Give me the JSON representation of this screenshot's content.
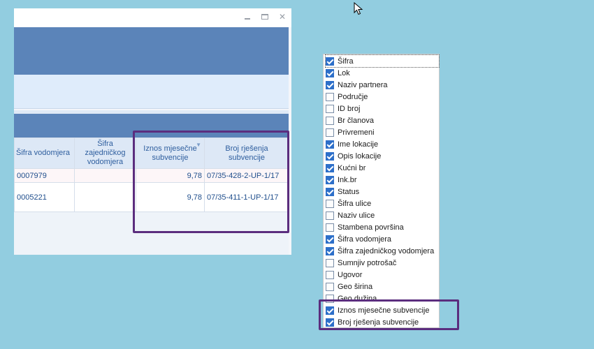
{
  "window": {
    "controls": {
      "minimize": "",
      "maximize": "",
      "close": "✕"
    }
  },
  "grid": {
    "columns": [
      {
        "label": "Šifra vodomjera"
      },
      {
        "label": "Šifra zajedničkog vodomjera"
      },
      {
        "label": "Iznos mjesečne subvencije",
        "filter_icon": "▼"
      },
      {
        "label": "Broj rješenja subvencije"
      }
    ],
    "rows": [
      [
        "0007979",
        "",
        "9,78",
        "07/35-428-2-UP-1/17"
      ],
      [
        "0005221",
        "",
        "9,78",
        "07/35-411-1-UP-1/17"
      ]
    ]
  },
  "column_chooser": {
    "items": [
      {
        "label": "Šifra",
        "checked": true
      },
      {
        "label": "Lok",
        "checked": true
      },
      {
        "label": "Naziv partnera",
        "checked": true
      },
      {
        "label": "Područje",
        "checked": false
      },
      {
        "label": "ID broj",
        "checked": false
      },
      {
        "label": "Br članova",
        "checked": false
      },
      {
        "label": "Privremeni",
        "checked": false
      },
      {
        "label": "Ime lokacije",
        "checked": true
      },
      {
        "label": "Opis lokacije",
        "checked": true
      },
      {
        "label": "Kućni br",
        "checked": true
      },
      {
        "label": "Ink.br",
        "checked": true
      },
      {
        "label": "Status",
        "checked": true
      },
      {
        "label": "Šifra ulice",
        "checked": false
      },
      {
        "label": "Naziv ulice",
        "checked": false
      },
      {
        "label": "Stambena površina",
        "checked": false
      },
      {
        "label": "Šifra vodomjera",
        "checked": true
      },
      {
        "label": "Šifra zajedničkog vodomjera",
        "checked": true
      },
      {
        "label": "Sumnjiv potrošač",
        "checked": false
      },
      {
        "label": "Ugovor",
        "checked": false
      },
      {
        "label": "Geo širina",
        "checked": false
      },
      {
        "label": "Geo dužina",
        "checked": false
      },
      {
        "label": "Iznos mjesečne subvencije",
        "checked": true
      },
      {
        "label": "Broj rješenja subvencije",
        "checked": true
      }
    ]
  },
  "colors": {
    "background": "#92cde0",
    "ribbon": "#5b84b9",
    "highlight": "#5b2d7e",
    "checkbox_checked": "#2d6fc9"
  },
  "icons": [
    "minimize-icon",
    "maximize-icon",
    "close-icon",
    "filter-icon",
    "checkbox-icon",
    "mouse-cursor-icon"
  ]
}
